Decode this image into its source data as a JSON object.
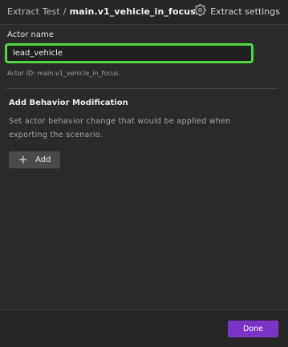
{
  "header": {
    "breadcrumb_root": "Extract Test",
    "breadcrumb_separator": "/",
    "breadcrumb_current": "main.v1_vehicle_in_focus",
    "settings_label": "Extract settings",
    "settings_icon": "gear-icon"
  },
  "actor": {
    "field_label": "Actor name",
    "name_value": "lead_vehicle",
    "id_text": "Actor ID: main.v1_vehicle_in_focus",
    "focus_color": "#4dd83f"
  },
  "behavior": {
    "title": "Add Behavior Modification",
    "description": "Set actor behavior change that would be applied when exporting the scenario.",
    "add_label": "Add",
    "add_icon": "plus-icon"
  },
  "footer": {
    "done_label": "Done",
    "done_color": "#7a35c7"
  }
}
